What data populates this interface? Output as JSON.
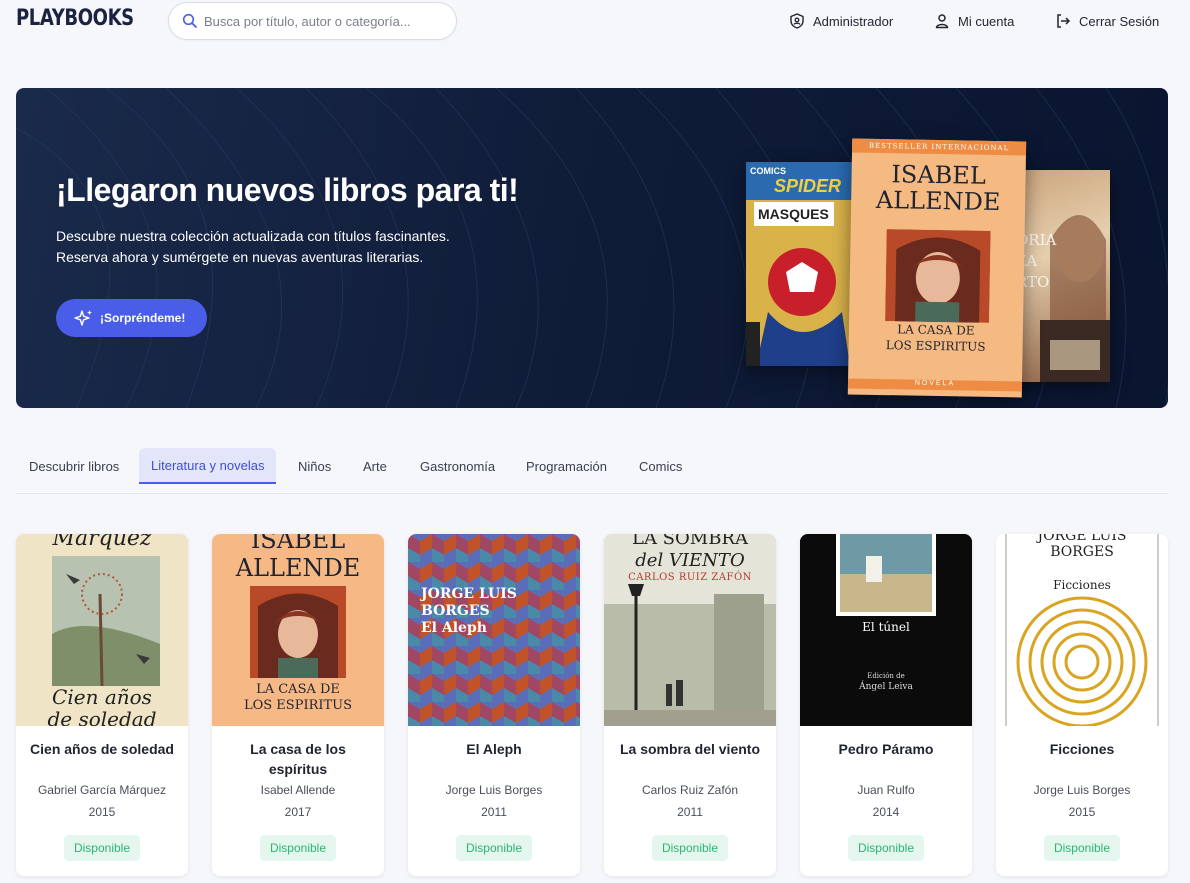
{
  "header": {
    "logo": "PLAYBOOKS",
    "search_placeholder": "Busca por título, autor o categoría...",
    "nav": [
      {
        "label": "Administrador",
        "icon": "shield-user-icon"
      },
      {
        "label": "Mi cuenta",
        "icon": "user-icon"
      },
      {
        "label": "Cerrar Sesión",
        "icon": "logout-icon"
      }
    ]
  },
  "hero": {
    "title": "¡Llegaron nuevos libros para ti!",
    "subtitle_line1": "Descubre nuestra colección actualizada con títulos fascinantes.",
    "subtitle_line2": "Reserva ahora y sumérgete en nuevas aventuras literarias.",
    "button_label": "¡Sorpréndeme!",
    "covers": {
      "left": {
        "top_text": "COMICS",
        "title": "MASQUES",
        "brand": "SPIDER"
      },
      "center": {
        "banner": "BESTSELLER INTERNACIONAL",
        "author_line1": "ISABEL",
        "author_line2": "ALLENDE",
        "title_line1": "LA CASA DE",
        "title_line2": "LOS ESPIRITUS",
        "footer": "NOVELA"
      },
      "right": {
        "line1": "ORIA",
        "line2": "ZA",
        "line3": "RTO"
      }
    }
  },
  "tabs": [
    {
      "label": "Descubrir libros",
      "active": false
    },
    {
      "label": "Literatura y novelas",
      "active": true
    },
    {
      "label": "Niños",
      "active": false
    },
    {
      "label": "Arte",
      "active": false
    },
    {
      "label": "Gastronomía",
      "active": false
    },
    {
      "label": "Programación",
      "active": false
    },
    {
      "label": "Comics",
      "active": false
    }
  ],
  "books": [
    {
      "title": "Cien años de soledad",
      "author": "Gabriel García Márquez",
      "year": "2015",
      "status": "Disponible",
      "cover": {
        "top": "Márquez",
        "bottom1": "Cien años",
        "bottom2": "de soledad"
      }
    },
    {
      "title": "La casa de los espíritus",
      "author": "Isabel Allende",
      "year": "2017",
      "status": "Disponible",
      "cover": {
        "top1": "ISABEL",
        "top2": "ALLENDE",
        "bottom1": "LA CASA DE",
        "bottom2": "LOS ESPIRITUS"
      }
    },
    {
      "title": "El Aleph",
      "author": "Jorge Luis Borges",
      "year": "2011",
      "status": "Disponible",
      "cover": {
        "line1": "JORGE LUIS",
        "line2": "BORGES",
        "line3": "El Aleph"
      }
    },
    {
      "title": "La sombra del viento",
      "author": "Carlos Ruiz Zafón",
      "year": "2011",
      "status": "Disponible",
      "cover": {
        "line1": "LA SOMBRA",
        "line2": "del VIENTO",
        "line3": "CARLOS RUIZ ZAFÓN"
      }
    },
    {
      "title": "Pedro Páramo",
      "author": "Juan Rulfo",
      "year": "2014",
      "status": "Disponible",
      "cover": {
        "line1": "El túnel",
        "line2": "Edición de",
        "line3": "Ángel Leiva"
      }
    },
    {
      "title": "Ficciones",
      "author": "Jorge Luis Borges",
      "year": "2015",
      "status": "Disponible",
      "cover": {
        "line1": "JORGE LUIS",
        "line2": "BORGES",
        "line3": "Ficciones"
      }
    }
  ],
  "colors": {
    "accent": "#4a5de8",
    "hero_bg": "#0f1c38",
    "badge_bg": "#e5f6ee",
    "badge_text": "#2bb673"
  }
}
